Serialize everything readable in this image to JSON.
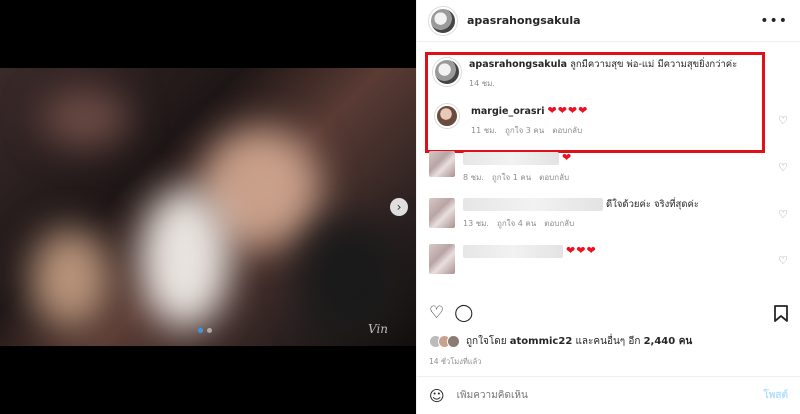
{
  "colors": {
    "highlight": "#e0101a",
    "heart": "#ed0f1f",
    "post_disabled": "#b2dffc",
    "muted": "#8e8e8e"
  },
  "media": {
    "signature": "Vin"
  },
  "header": {
    "username": "apasrahongsakula",
    "more_icon": "more-horizontal-icon"
  },
  "caption": {
    "username": "apasrahongsakula",
    "text": "ลูกมีความสุข พ่อ-แม่ มีความสุขยิ่งกว่าค่ะ",
    "time": "14 ชม."
  },
  "comments": [
    {
      "username": "margie_orasri",
      "text": "❤❤❤❤",
      "time": "11 ชม.",
      "likes": "ถูกใจ 3 คน",
      "reply": "ตอบกลับ"
    },
    {
      "username": "",
      "text": "❤",
      "time": "8 ชม.",
      "likes": "ถูกใจ 1 คน",
      "reply": "ตอบกลับ"
    },
    {
      "username": "",
      "text": "ดีใจด้วยค่ะ จริงที่สุดค่ะ",
      "time": "13 ชม.",
      "likes": "ถูกใจ 4 คน",
      "reply": "ตอบกลับ"
    },
    {
      "username": "",
      "text": "❤❤❤",
      "time": "",
      "likes": "",
      "reply": ""
    }
  ],
  "actions": {
    "like_icon": "heart-outline-icon",
    "comment_icon": "comment-icon",
    "save_icon": "bookmark-icon"
  },
  "likes_line": {
    "prefix": "ถูกใจโดย",
    "user": "atommic22",
    "middle": "และคนอื่นๆ อีก",
    "count": "2,440 คน"
  },
  "post_time": "14 ชั่วโมงที่แล้ว",
  "add_comment": {
    "placeholder": "เพิ่มความคิดเห็น",
    "post_label": "โพสต์"
  }
}
